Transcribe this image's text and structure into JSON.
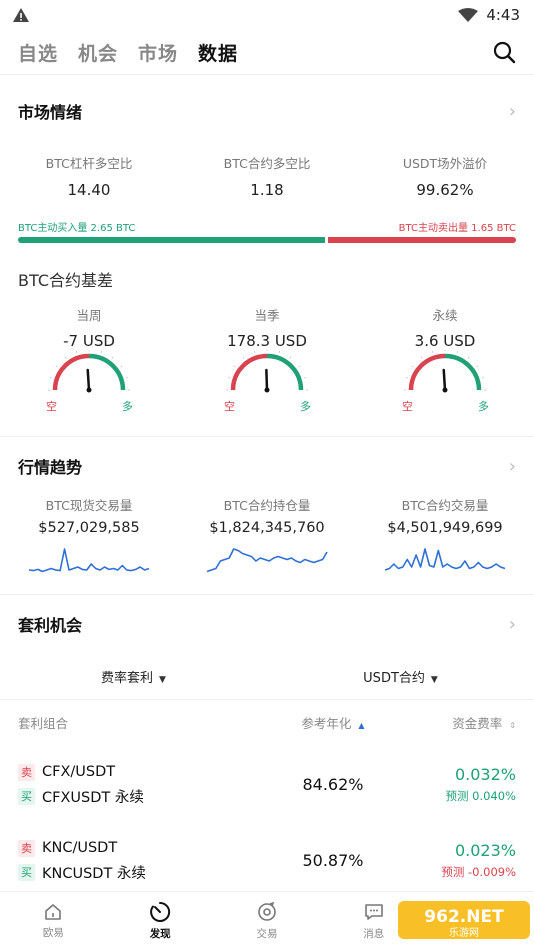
{
  "status": {
    "time": "4:43"
  },
  "top_tabs": [
    {
      "label": "自选",
      "active": false
    },
    {
      "label": "机会",
      "active": false
    },
    {
      "label": "市场",
      "active": false
    },
    {
      "label": "数据",
      "active": true
    }
  ],
  "sentiment": {
    "title": "市场情绪",
    "metrics": [
      {
        "label": "BTC杠杆多空比",
        "value": "14.40"
      },
      {
        "label": "BTC合约多空比",
        "value": "1.18"
      },
      {
        "label": "USDT场外溢价",
        "value": "99.62%"
      }
    ],
    "buy_label": "BTC主动买入量 2.65 BTC",
    "sell_label": "BTC主动卖出量 1.65 BTC",
    "buy_ratio": 0.616
  },
  "basis": {
    "title": "BTC合约基差",
    "gauges": [
      {
        "label": "当周",
        "value": "-7 USD",
        "short_label": "空",
        "long_label": "多",
        "needle": 0.48
      },
      {
        "label": "当季",
        "value": "178.3 USD",
        "short_label": "空",
        "long_label": "多",
        "needle": 0.49
      },
      {
        "label": "永续",
        "value": "3.6 USD",
        "short_label": "空",
        "long_label": "多",
        "needle": 0.48
      }
    ]
  },
  "trend": {
    "title": "行情趋势",
    "items": [
      {
        "label": "BTC现货交易量",
        "value": "$527,029,585",
        "spark": [
          0.2,
          0.18,
          0.22,
          0.15,
          0.2,
          0.25,
          0.2,
          0.18,
          0.9,
          0.2,
          0.25,
          0.3,
          0.22,
          0.2,
          0.4,
          0.25,
          0.2,
          0.3,
          0.22,
          0.25,
          0.2,
          0.35,
          0.2,
          0.18,
          0.22,
          0.3,
          0.2,
          0.25
        ]
      },
      {
        "label": "BTC合约持仓量",
        "value": "$1,824,345,760",
        "spark": [
          0.15,
          0.2,
          0.25,
          0.5,
          0.55,
          0.6,
          0.9,
          0.85,
          0.75,
          0.7,
          0.65,
          0.5,
          0.6,
          0.55,
          0.5,
          0.6,
          0.65,
          0.6,
          0.55,
          0.6,
          0.5,
          0.45,
          0.55,
          0.5,
          0.45,
          0.5,
          0.55,
          0.8
        ]
      },
      {
        "label": "BTC合约交易量",
        "value": "$4,501,949,699",
        "spark": [
          0.2,
          0.25,
          0.4,
          0.25,
          0.3,
          0.55,
          0.3,
          0.7,
          0.3,
          0.9,
          0.35,
          0.3,
          0.85,
          0.3,
          0.4,
          0.3,
          0.25,
          0.3,
          0.5,
          0.25,
          0.3,
          0.45,
          0.3,
          0.25,
          0.3,
          0.4,
          0.3,
          0.25
        ]
      }
    ]
  },
  "arbitrage": {
    "title": "套利机会",
    "filter_left": "费率套利",
    "filter_right": "USDT合约",
    "col_pair": "套利组合",
    "col_annual": "参考年化",
    "col_rate": "资金费率",
    "rows": [
      {
        "sell_tag": "卖",
        "buy_tag": "买",
        "sell_pair": "CFX/USDT",
        "buy_pair": "CFXUSDT 永续",
        "annual": "84.62%",
        "rate": "0.032%",
        "forecast": "预测 0.040%",
        "forecast_color": "#1fa175"
      },
      {
        "sell_tag": "卖",
        "buy_tag": "买",
        "sell_pair": "KNC/USDT",
        "buy_pair": "KNCUSDT 永续",
        "annual": "50.87%",
        "rate": "0.023%",
        "forecast": "预测 -0.009%",
        "forecast_color": "#d9434f"
      }
    ]
  },
  "bottom_nav": [
    {
      "label": "欧易",
      "icon": "home-icon",
      "active": false
    },
    {
      "label": "发现",
      "icon": "discover-icon",
      "active": true
    },
    {
      "label": "交易",
      "icon": "trade-icon",
      "active": false
    },
    {
      "label": "消息",
      "icon": "message-icon",
      "active": false
    }
  ],
  "watermark": {
    "brand": "962.NET",
    "sub": "乐游网"
  },
  "colors": {
    "green": "#1fa175",
    "red": "#d9434f",
    "blue": "#2f6fd6"
  }
}
